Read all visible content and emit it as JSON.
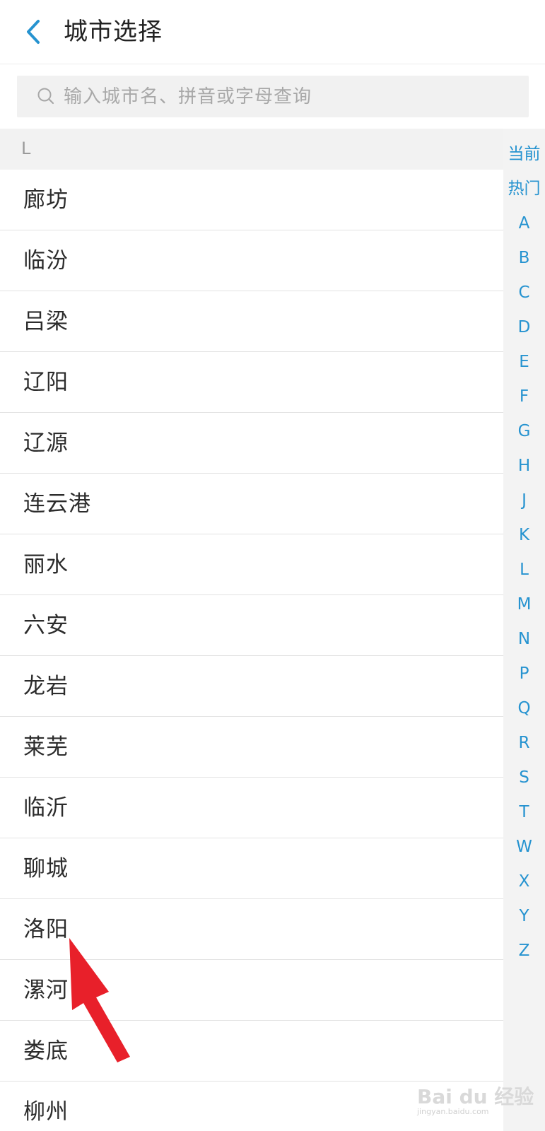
{
  "header": {
    "title": "城市选择",
    "back_icon": "chevron-left-icon"
  },
  "search": {
    "placeholder": "输入城市名、拼音或字母查询",
    "value": "",
    "icon": "search-icon"
  },
  "section": {
    "letter": "L"
  },
  "cities": [
    "廊坊",
    "临汾",
    "吕梁",
    "辽阳",
    "辽源",
    "连云港",
    "丽水",
    "六安",
    "龙岩",
    "莱芜",
    "临沂",
    "聊城",
    "洛阳",
    "漯河",
    "娄底",
    "柳州"
  ],
  "index": [
    "当前",
    "热门",
    "A",
    "B",
    "C",
    "D",
    "E",
    "F",
    "G",
    "H",
    "J",
    "K",
    "L",
    "M",
    "N",
    "P",
    "Q",
    "R",
    "S",
    "T",
    "W",
    "X",
    "Y",
    "Z"
  ],
  "colors": {
    "accent": "#2693d0",
    "annotation": "#e8202a",
    "divider": "#e2e2e2"
  },
  "watermark": {
    "brand": "Bai du 经验",
    "url": "jingyan.baidu.com"
  }
}
